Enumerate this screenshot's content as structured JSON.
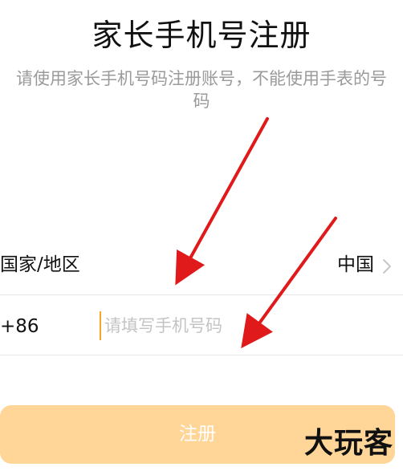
{
  "page": {
    "title": "家长手机号注册",
    "subtitle": "请使用家长手机号码注册账号，不能使用手表的号码"
  },
  "region_row": {
    "label": "国家/地区",
    "value": "中国",
    "chevron_icon": "chevron-right-icon"
  },
  "phone_row": {
    "dial_code": "+86",
    "input_value": "",
    "input_placeholder": "请填写手机号码"
  },
  "register_button": {
    "label": "注册"
  },
  "watermark": {
    "text": "大玩客"
  },
  "colors": {
    "button_background": "#ffd697",
    "button_text": "#ffffff",
    "cursor": "#f5a623",
    "annotation_arrow": "#e01a1a",
    "subtitle_text": "#9a9a9a",
    "placeholder_text": "#c4c4c4"
  }
}
